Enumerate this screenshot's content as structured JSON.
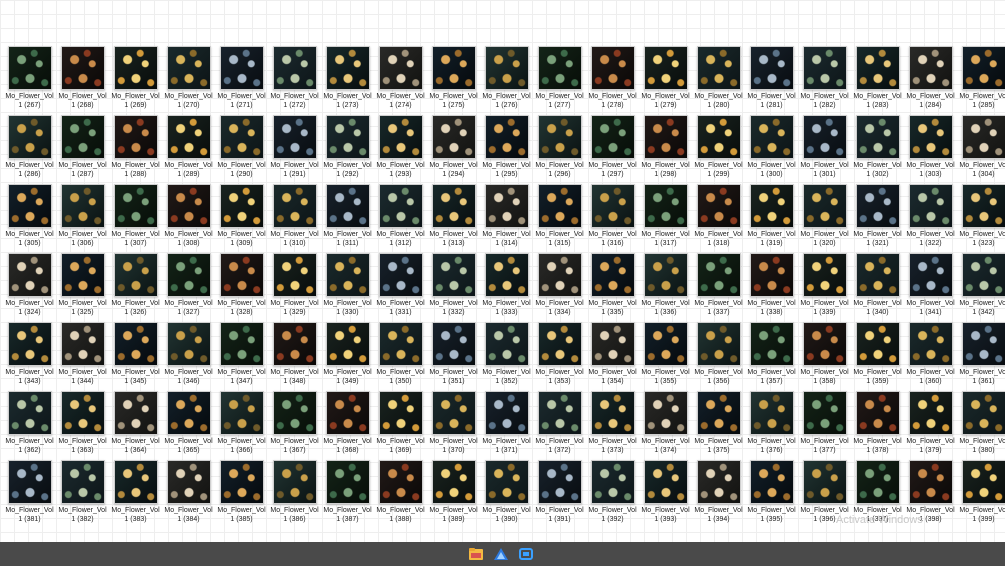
{
  "file_prefix": "Mo_Flower_Vol 1",
  "start_index": 267,
  "end_index": 399,
  "columns": 19,
  "watermark": "Activate Windows",
  "palettes": [
    [
      "#d9b45a",
      "#8a6a2a",
      "#1b2a2c",
      "#0c1416"
    ],
    [
      "#e8c77a",
      "#b28a3c",
      "#18292a",
      "#070d0e"
    ],
    [
      "#c9a04a",
      "#6e5a2a",
      "#223533",
      "#0a1212"
    ],
    [
      "#f0d27a",
      "#d39b3a",
      "#1a2420",
      "#080c0b"
    ],
    [
      "#b9c7a8",
      "#6a8a6a",
      "#1c2b2f",
      "#0d1518"
    ],
    [
      "#dca85a",
      "#9b6b2c",
      "#13202a",
      "#05090c"
    ],
    [
      "#c88a4a",
      "#8a3a20",
      "#221a18",
      "#0a0807"
    ],
    [
      "#a8b8c8",
      "#5a7288",
      "#18222c",
      "#080c10"
    ],
    [
      "#e0d2b8",
      "#a0927a",
      "#2a2a28",
      "#121210"
    ],
    [
      "#7aa07a",
      "#3d6a4a",
      "#142418",
      "#070d08"
    ]
  ],
  "taskbar": {
    "icons": [
      "file-explorer-icon",
      "drive-icon",
      "screen-capture-icon"
    ]
  }
}
